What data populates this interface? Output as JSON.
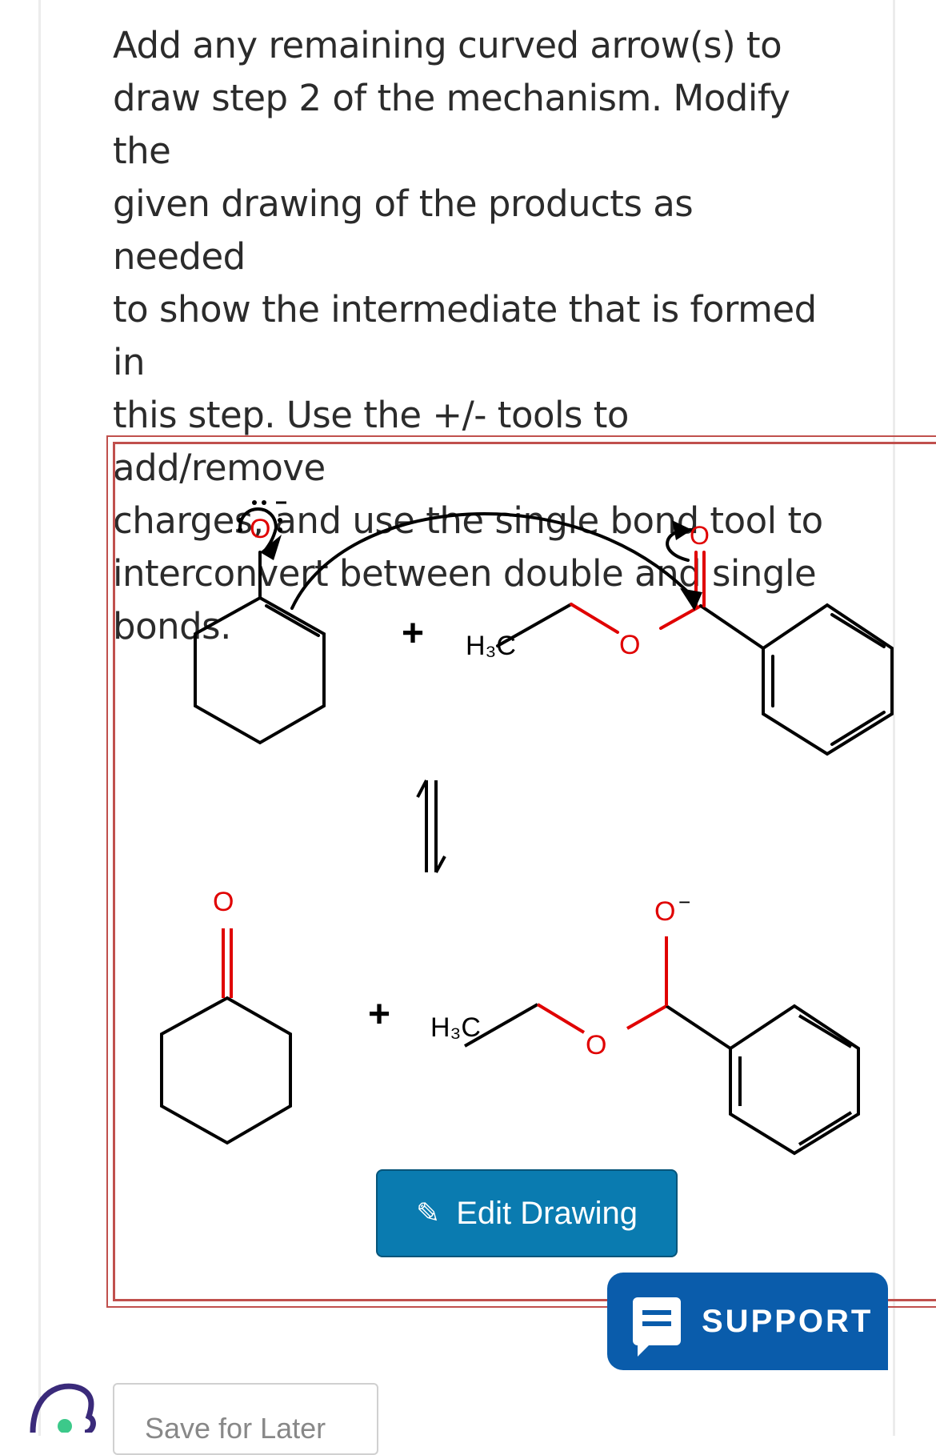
{
  "question": {
    "text": "Add any remaining curved arrow(s) to\ndraw step 2 of the mechanism. Modify the\ngiven drawing of the products as needed\nto show the intermediate that is formed in\nthis step. Use the +/- tools to add/remove\ncharges, and use the single bond tool to\ninterconvert between double and single\nbonds."
  },
  "drawing": {
    "plus_top": "+",
    "plus_bottom": "+",
    "h3c_top": "H₃C",
    "h3c_bottom": "H₃C",
    "oxygen_label": "O",
    "charge_minus": "−"
  },
  "buttons": {
    "edit_label": "Edit Drawing",
    "support_label": "SUPPORT",
    "save_label": "Save for Later"
  },
  "colors": {
    "oxygen": "#e00000",
    "frame": "#c0504d",
    "edit_bg": "#0a7bb0",
    "support_bg": "#0a5cab"
  }
}
